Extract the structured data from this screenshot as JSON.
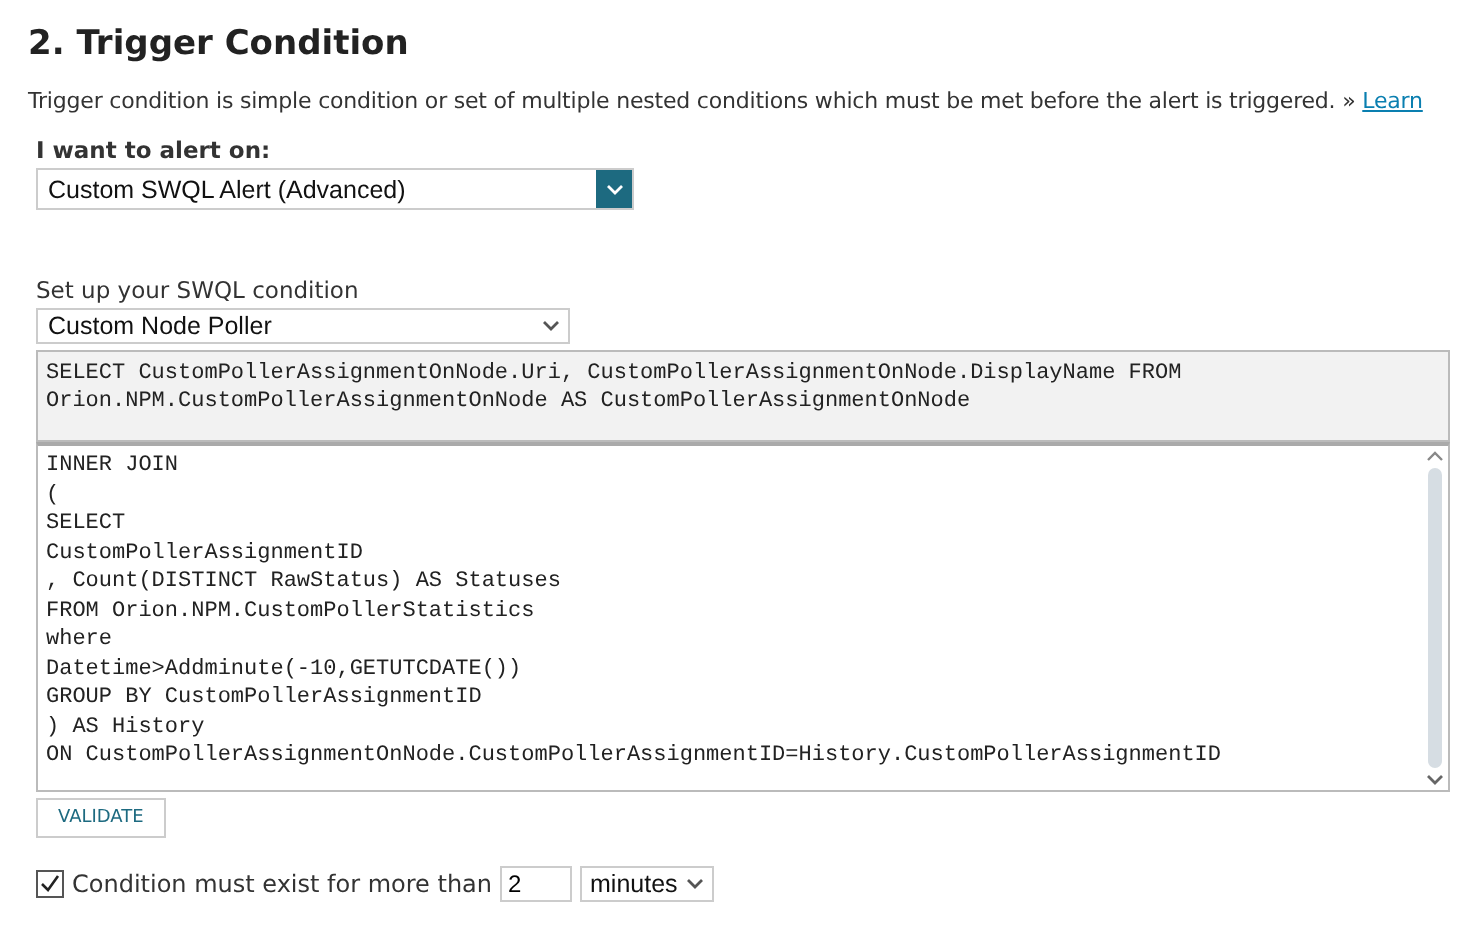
{
  "heading": "2. Trigger Condition",
  "description": {
    "text": "Trigger condition is simple condition or set of multiple nested conditions which must be met before the alert is triggered. »",
    "link": "Learn"
  },
  "alert_on": {
    "label": "I want to alert on:",
    "value": "Custom SWQL Alert (Advanced)"
  },
  "swql": {
    "label": "Set up your SWQL condition",
    "value": "Custom Node Poller"
  },
  "query_fixed": [
    "SELECT CustomPollerAssignmentOnNode.Uri, CustomPollerAssignmentOnNode.DisplayName FROM",
    "Orion.NPM.CustomPollerAssignmentOnNode AS CustomPollerAssignmentOnNode"
  ],
  "query_editor": [
    "INNER JOIN",
    "(",
    "SELECT",
    "CustomPollerAssignmentID",
    ", Count(DISTINCT RawStatus) AS Statuses",
    "FROM Orion.NPM.CustomPollerStatistics",
    "where",
    "Datetime>Addminute(-10,GETUTCDATE())",
    "GROUP BY CustomPollerAssignmentID",
    ") AS History",
    "ON CustomPollerAssignmentOnNode.CustomPollerAssignmentID=History.CustomPollerAssignmentID"
  ],
  "validate_button": "VALIDATE",
  "duration": {
    "checked": true,
    "label": "Condition must exist for more than",
    "value": "2",
    "unit": "minutes"
  }
}
